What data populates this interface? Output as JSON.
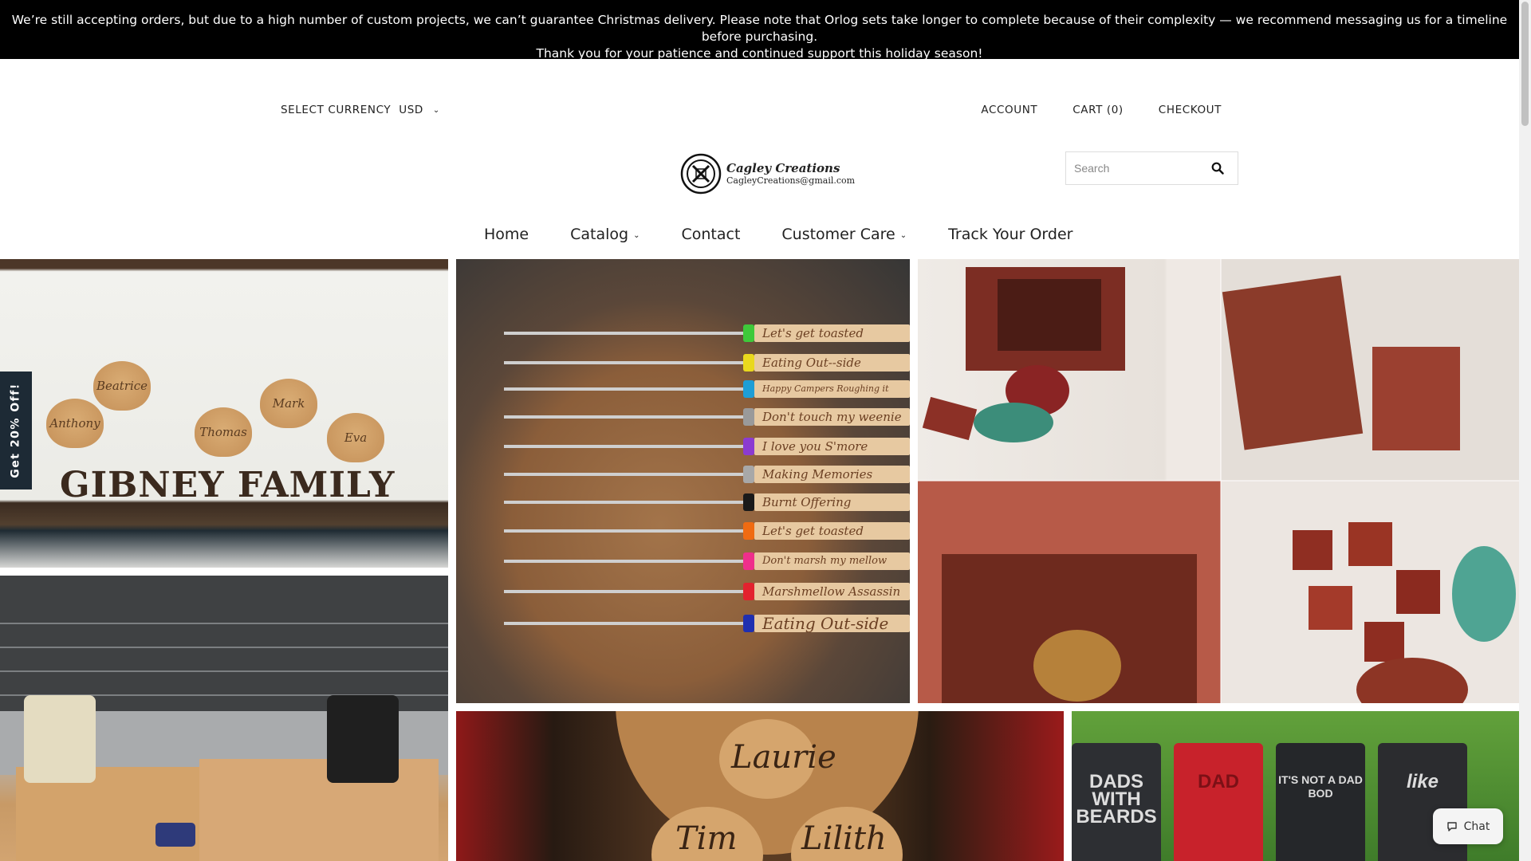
{
  "announcement": {
    "line1": "We’re still accepting orders, but due to a high number of custom projects, we can’t guarantee Christmas delivery. Please note that Orlog sets take longer to complete because of their complexity — we recommend messaging us for a timeline before purchasing.",
    "line2": "Thank you for your patience and continued support this holiday season!"
  },
  "currency": {
    "label": "SELECT CURRENCY",
    "value": "USD"
  },
  "util_links": {
    "account": "ACCOUNT",
    "cart": "CART (0)",
    "checkout": "CHECKOUT"
  },
  "logo": {
    "name": "Cagley Creations",
    "email": "CagleyCreations@gmail.com"
  },
  "search": {
    "placeholder": "Search"
  },
  "nav": {
    "home": "Home",
    "catalog": "Catalog",
    "contact": "Contact",
    "customer_care": "Customer Care",
    "track": "Track Your Order"
  },
  "gallery": {
    "sign": {
      "family": "GIBNEY FAMILY",
      "names": [
        "Beatrice",
        "Anthony",
        "Thomas",
        "Mark",
        "Eva"
      ]
    },
    "forks": [
      "Let's get toasted",
      "Eating Out--side",
      "Happy Campers Roughing it",
      "Don't touch my weenie",
      "I love you S'more",
      "Making Memories",
      "Burnt Offering",
      "Let's get toasted",
      "Don't marsh my mellow",
      "Marshmellow Assassin",
      "Eating Out-side"
    ],
    "ornament": {
      "names": [
        "Laurie",
        "Tim",
        "Lilith"
      ]
    },
    "tumblers": [
      "DADS WITH BEARDS",
      "DAD",
      "IT'S NOT A DAD BOD",
      "like"
    ]
  },
  "promo": {
    "label": "Get 20% Off!"
  },
  "chat": {
    "label": "Chat"
  },
  "colors": {
    "announcement_bg": "#000000",
    "promo_bg": "#1d2a35",
    "text": "#222222"
  }
}
